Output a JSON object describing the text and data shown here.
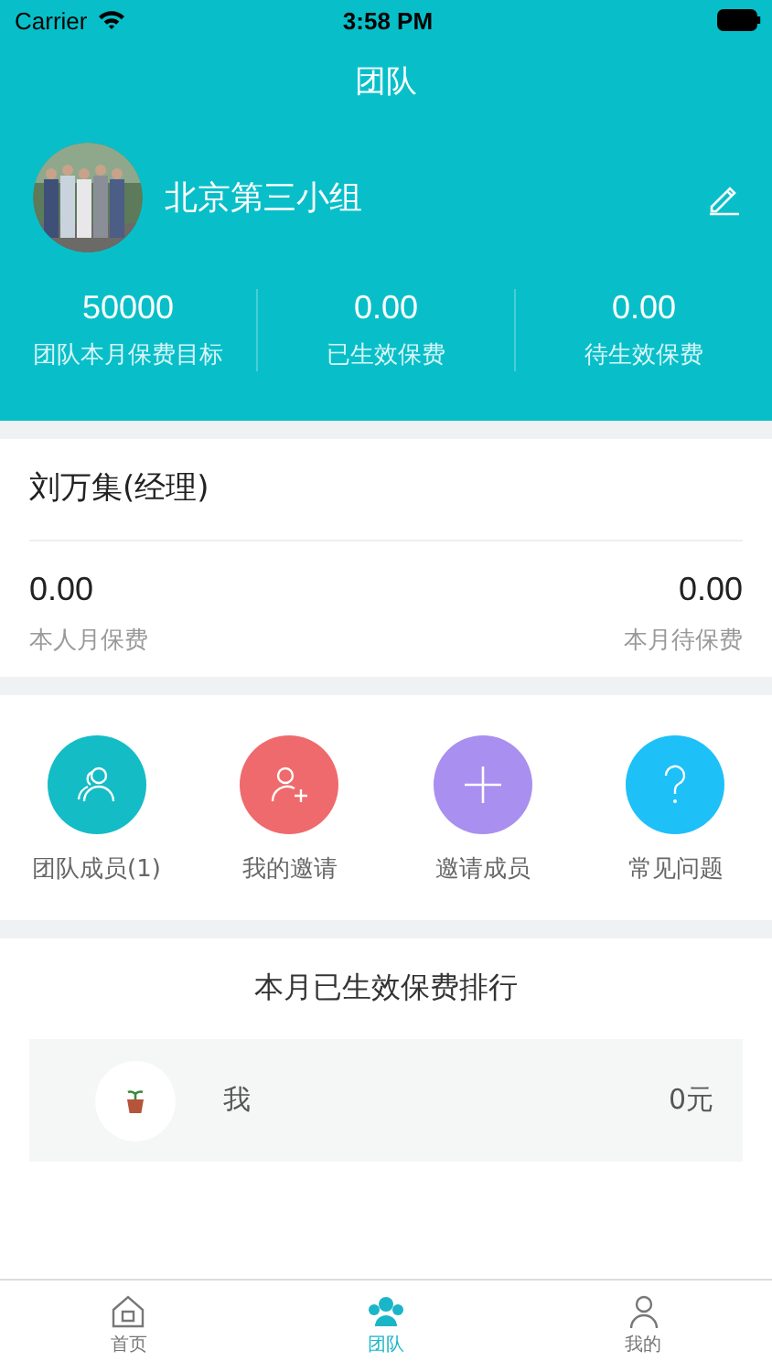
{
  "status_bar": {
    "carrier": "Carrier",
    "time": "3:58 PM"
  },
  "nav": {
    "title": "团队"
  },
  "team": {
    "name": "北京第三小组",
    "stats": [
      {
        "value": "50000",
        "label": "团队本月保费目标"
      },
      {
        "value": "0.00",
        "label": "已生效保费"
      },
      {
        "value": "0.00",
        "label": "待生效保费"
      }
    ]
  },
  "manager": {
    "name": "刘万集(经理)",
    "left": {
      "value": "0.00",
      "label": "本人月保费"
    },
    "right": {
      "value": "0.00",
      "label": "本月待保费"
    }
  },
  "actions": [
    {
      "kind": "members",
      "label": "团队成员(1)",
      "color": "#14bcc6"
    },
    {
      "kind": "invite",
      "label": "我的邀请",
      "color": "#ef6a6c"
    },
    {
      "kind": "add",
      "label": "邀请成员",
      "color": "#a98ff0"
    },
    {
      "kind": "help",
      "label": "常见问题",
      "color": "#1ec0f8"
    }
  ],
  "ranking": {
    "title": "本月已生效保费排行",
    "rows": [
      {
        "name": "我",
        "amount": "0元"
      }
    ]
  },
  "tab_bar": [
    {
      "kind": "home",
      "label": "首页",
      "selected": false
    },
    {
      "kind": "team",
      "label": "团队",
      "selected": true
    },
    {
      "kind": "me",
      "label": "我的",
      "selected": false
    }
  ]
}
